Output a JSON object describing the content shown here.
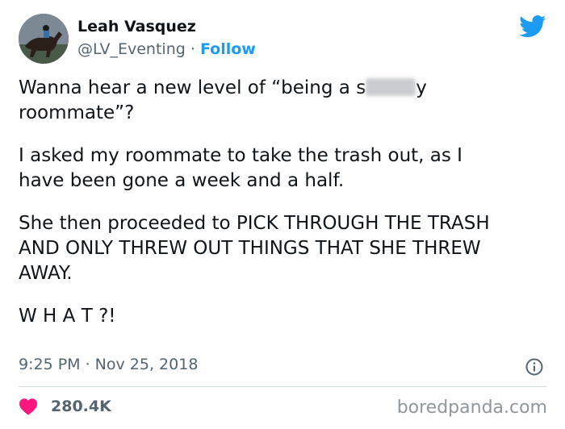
{
  "tweet": {
    "author_name": "Leah Vasquez",
    "handle": "@LV_Eventing",
    "separator": " · ",
    "follow_label": "Follow",
    "paragraph1_before_blur": "Wanna hear a new level of “being a s",
    "paragraph1_after_blur": "y\nroommate”?",
    "paragraph2": "I asked my roommate to take the trash out, as I\nhave been gone a week and a half.",
    "paragraph3": "She then proceeded to PICK THROUGH THE TRASH\nAND ONLY THREW OUT THINGS THAT SHE THREW\nAWAY.",
    "paragraph4": "W H A T ?!",
    "timestamp": "9:25 PM · Nov 25, 2018",
    "likes": "280.4K"
  },
  "watermark": "boredpanda.com",
  "icons": {
    "platform": "twitter-bird-icon",
    "info": "info-icon",
    "like": "heart-icon"
  },
  "colors": {
    "accent": "#1d9bf0",
    "heart": "#f91880",
    "text": "#0f1419",
    "secondary_text": "#536471"
  }
}
